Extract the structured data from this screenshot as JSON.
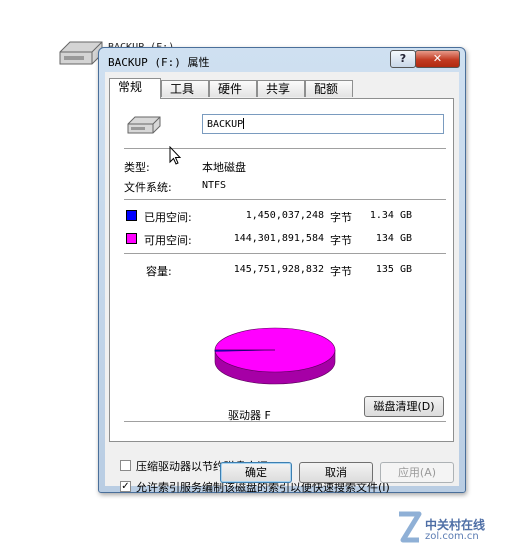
{
  "window": {
    "title": "BACKUP (F:) 属性",
    "help_glyph": "?",
    "close_glyph": "✕"
  },
  "desktop": {
    "label": "BACKUP (F:)"
  },
  "tabs": [
    "常规",
    "工具",
    "硬件",
    "共享",
    "配额"
  ],
  "general": {
    "volume_name": "BACKUP",
    "type_label": "类型:",
    "type_value": "本地磁盘",
    "fs_label": "文件系统:",
    "fs_value": "NTFS",
    "used": {
      "label": "已用空间:",
      "bytes": "1,450,037,248",
      "unit": "字节",
      "size": "1.34 GB",
      "color": "#0000ff"
    },
    "free": {
      "label": "可用空间:",
      "bytes": "144,301,891,584",
      "unit": "字节",
      "size": "134 GB",
      "color": "#ff00ff"
    },
    "capacity": {
      "label": "容量:",
      "bytes": "145,751,928,832",
      "unit": "字节",
      "size": "135 GB"
    },
    "used_fraction": 0.00995,
    "drive_label": "驱动器 F",
    "cleanup_button": "磁盘清理(D)",
    "compress_label": "压缩驱动器以节约磁盘空间(C)",
    "compress_checked": false,
    "index_label": "允许索引服务编制该磁盘的索引以便快速搜索文件(I)",
    "index_checked": true
  },
  "buttons": {
    "ok": "确定",
    "cancel": "取消",
    "apply": "应用(A)"
  },
  "watermark": {
    "cn": "中关村在线",
    "en": "zol.com.cn"
  }
}
